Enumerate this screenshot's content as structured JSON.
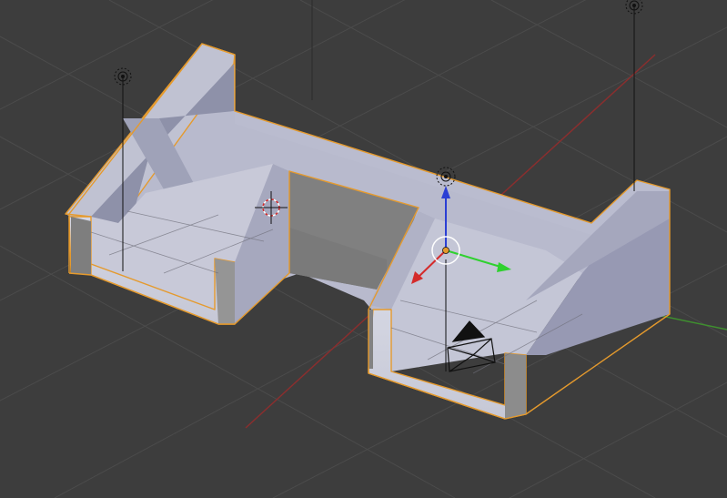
{
  "viewport": {
    "view": "perspective",
    "grid": true,
    "background_color": "#3d3d3d",
    "grid_color": "#4b4b4b",
    "x_axis_color": "#8a2e2e",
    "y_axis_color": "#3f8f2f",
    "selection_outline_color": "#e59a2d"
  },
  "scene": {
    "mesh_object": {
      "icon": "mesh-object",
      "selected": true,
      "color": "#a9abc4"
    },
    "lamps": [
      {
        "icon": "lamp-icon"
      },
      {
        "icon": "lamp-icon"
      },
      {
        "icon": "lamp-icon"
      }
    ],
    "camera": {
      "icon": "camera-icon"
    },
    "cursor_3d": {
      "icon": "3d-cursor-icon"
    },
    "transform_gizmo": {
      "x_color": "#d42b2b",
      "y_color": "#2fd12f",
      "z_color": "#2b3fd4",
      "pivot_icon": "pivot-point-icon"
    }
  }
}
